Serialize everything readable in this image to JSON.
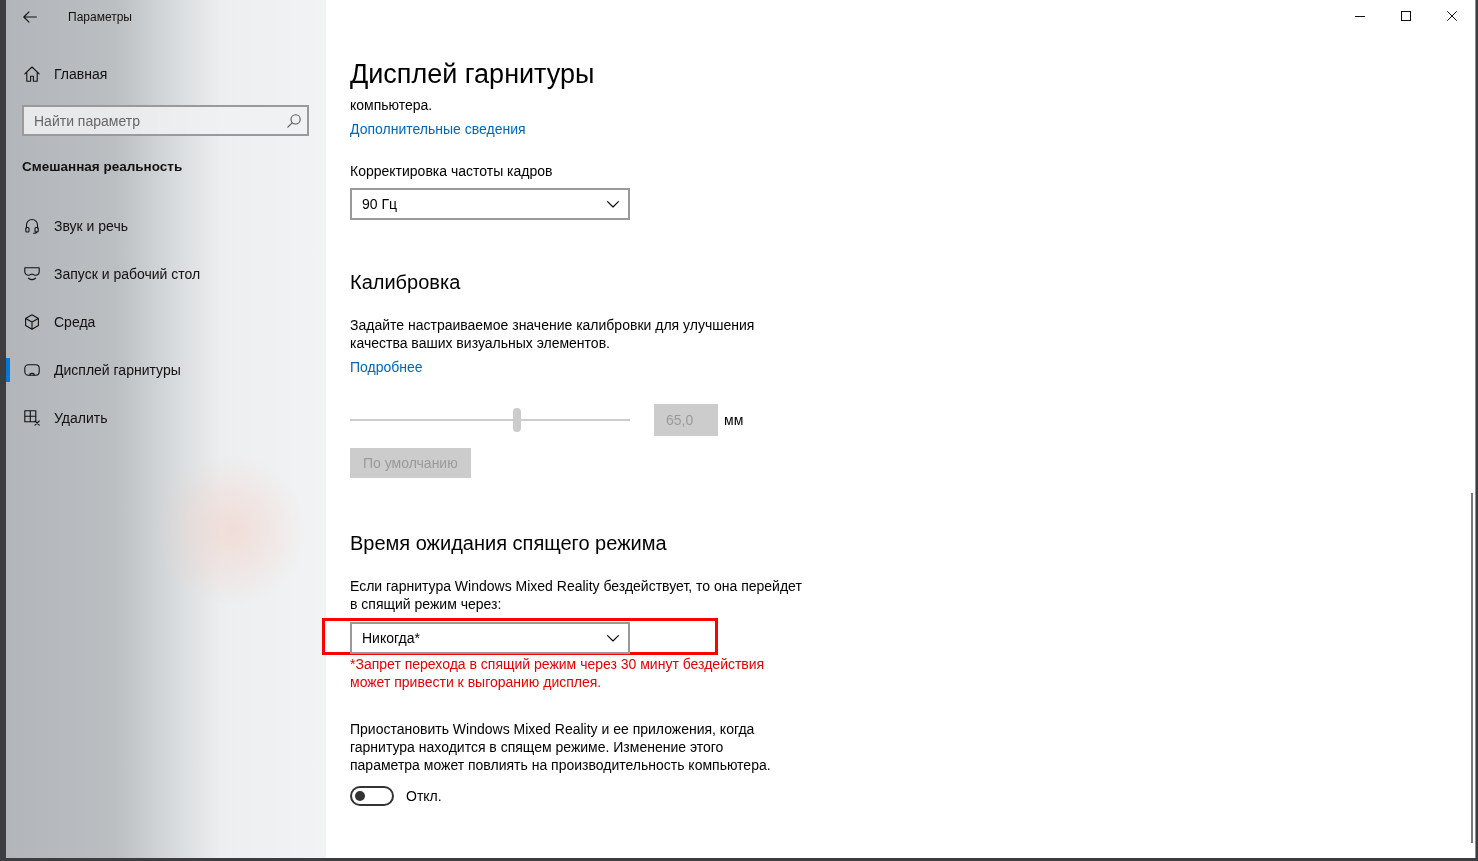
{
  "window": {
    "title": "Параметры"
  },
  "sidebar": {
    "home": "Главная",
    "search": {
      "placeholder": "Найти параметр"
    },
    "section": "Смешанная реальность",
    "items": [
      {
        "label": "Звук и речь",
        "selected": false
      },
      {
        "label": "Запуск и рабочий стол",
        "selected": false
      },
      {
        "label": "Среда",
        "selected": false
      },
      {
        "label": "Дисплей гарнитуры",
        "selected": true
      },
      {
        "label": "Удалить",
        "selected": false
      }
    ]
  },
  "content": {
    "title": "Дисплей гарнитуры",
    "sections": [
      {
        "blocks": [
          {
            "kind": "text",
            "text": "компьютера."
          },
          {
            "kind": "link",
            "text": "Дополнительные сведения"
          },
          {
            "kind": "label",
            "text": "Корректировка частоты кадров"
          },
          {
            "kind": "dropdown",
            "value": "90 Гц",
            "highlighted": false
          }
        ]
      },
      {
        "heading": "Калибровка",
        "blocks": [
          {
            "kind": "text",
            "text": "Задайте настраиваемое значение калибровки для улучшения\nкачества ваших визуальных элементов."
          },
          {
            "kind": "link",
            "text": "Подробнее"
          },
          {
            "kind": "slider",
            "level": 0.6,
            "value": "65,0",
            "unit": "мм",
            "disabled": true
          },
          {
            "kind": "button",
            "text": "По умолчанию",
            "disabled": true
          }
        ]
      },
      {
        "heading": "Время ожидания спящего режима",
        "blocks": [
          {
            "kind": "text",
            "text": "Если гарнитура Windows Mixed Reality бездействует, то она перейдет\nв спящий режим через:"
          },
          {
            "kind": "dropdown",
            "value": "Никогда*",
            "highlighted": true
          },
          {
            "kind": "note",
            "text": "*Запрет перехода в спящий режим через 30 минут бездействия\nможет привести к выгоранию дисплея."
          },
          {
            "kind": "text",
            "text": "Приостановить Windows Mixed Reality и ее приложения, когда\nгарнитура находится в спящем режиме. Изменение этого\nпараметра может повлиять на производительность компьютера."
          },
          {
            "kind": "toggle",
            "on": false,
            "label": "Откл."
          }
        ]
      }
    ]
  }
}
